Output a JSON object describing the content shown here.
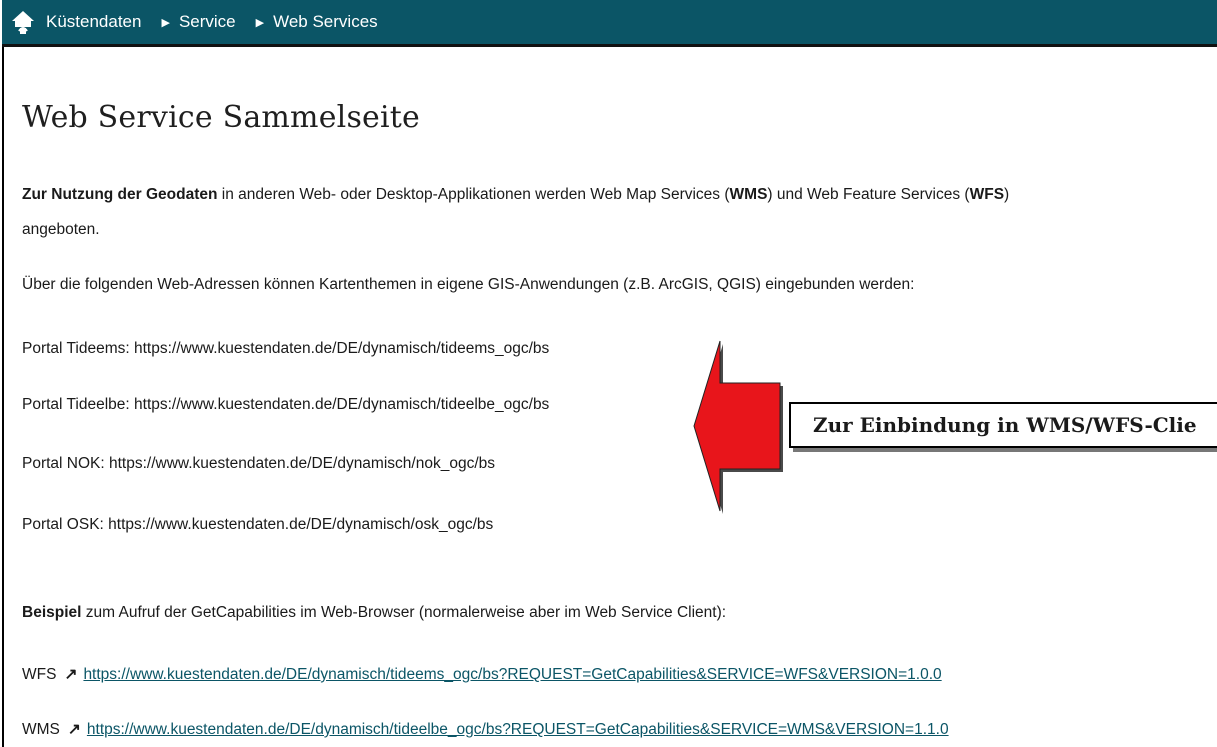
{
  "breadcrumb": {
    "home_icon": "home-icon",
    "items": [
      "Küstendaten",
      "Service",
      "Web Services"
    ]
  },
  "page": {
    "title": "Web Service Sammelseite"
  },
  "intro": {
    "bold": "Zur Nutzung der Geodaten",
    "t1": " in anderen Web- oder Desktop-Applikationen werden Web Map Services (",
    "wms": "WMS",
    "t2": ") und Web Feature Services (",
    "wfs": "WFS",
    "t3": ")",
    "line2": "angeboten."
  },
  "sentence": "Über die folgenden Web-Adressen können Kartenthemen in eigene GIS-Anwendungen (z.B. ArcGIS, QGIS) eingebunden werden:",
  "portals": [
    "Portal Tideems: https://www.kuestendaten.de/DE/dynamisch/tideems_ogc/bs",
    "Portal Tideelbe: https://www.kuestendaten.de/DE/dynamisch/tideelbe_ogc/bs",
    "Portal NOK: https://www.kuestendaten.de/DE/dynamisch/nok_ogc/bs",
    "Portal OSK: https://www.kuestendaten.de/DE/dynamisch/osk_ogc/bs"
  ],
  "example": {
    "bold": "Beispiel",
    "text": " zum Aufruf der GetCapabilities im Web-Browser (normalerweise aber im Web Service Client):"
  },
  "links": [
    {
      "label": "WFS",
      "icon": "external-link-icon",
      "url": "https://www.kuestendaten.de/DE/dynamisch/tideems_ogc/bs?REQUEST=GetCapabilities&SERVICE=WFS&VERSION=1.0.0"
    },
    {
      "label": "WMS",
      "icon": "external-link-icon",
      "url": "https://www.kuestendaten.de/DE/dynamisch/tideelbe_ogc/bs?REQUEST=GetCapabilities&SERVICE=WMS&VERSION=1.1.0"
    }
  ],
  "annotation": {
    "text": "Zur Einbindung in WMS/WFS-Clie",
    "arrow_color": "#e8151b"
  },
  "colors": {
    "header_bg": "#0b5566",
    "link": "#0b5566"
  }
}
